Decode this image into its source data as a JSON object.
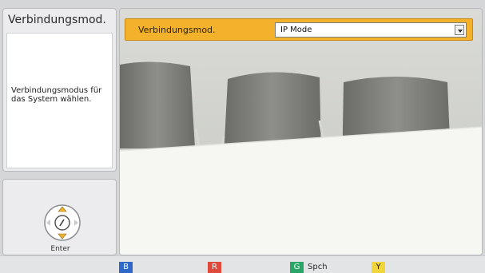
{
  "screen": {
    "title": "Verbindungsmod."
  },
  "description": {
    "text": "Verbindungsmodus für das System wählen."
  },
  "setting": {
    "label": "Verbindungsmod.",
    "value": "IP Mode"
  },
  "nav": {
    "enter_label": "Enter"
  },
  "color_keys": [
    {
      "key": "B",
      "label": "",
      "color": "#2f67c8"
    },
    {
      "key": "R",
      "label": "",
      "color": "#e04a3c"
    },
    {
      "key": "G",
      "label": "Spch",
      "color": "#2aa568"
    },
    {
      "key": "Y",
      "label": "",
      "color": "#f1d63b"
    }
  ],
  "colors": {
    "highlight": "#f3b12c"
  }
}
